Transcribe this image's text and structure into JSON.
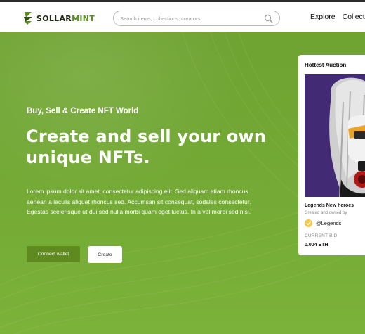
{
  "brand": {
    "name_prefix": "SOLLAR",
    "name_suffix": "MINT"
  },
  "search": {
    "placeholder": "Search items, collections, creators"
  },
  "nav": {
    "items": [
      "Explore",
      "Collections"
    ]
  },
  "hero": {
    "subtitle": "Buy, Sell & Create NFT World",
    "headline": "Create and sell your own unique NFTs.",
    "description": "Lorem ipsum dolor sit amet, consectetur adipiscing elit. Sed aliquam etiam rhoncus aenean a iaculis aliquet rhoncus sed. Accumsan sit consequat, sodales consectetur. Egestas scelerisque ut dui sed nulla morbi quam eget luctus. In a vel morbi sed nisi.",
    "connect_label": "Connect wallet",
    "create_label": "Create"
  },
  "auction": {
    "title": "Hottest Auction",
    "item_name": "Legends New heroes",
    "created_by_label": "Created and owned by",
    "owner_handle": "@Legends",
    "bid_label": "CURRENT BID",
    "bid_value": "0.004 ETH"
  },
  "colors": {
    "brand_green": "#5a8f1f",
    "hero_green": "#72a834",
    "connect_button": "#5e8a1f",
    "verified_badge": "#f2c94c"
  },
  "icons": [
    "logo-icon",
    "search-icon",
    "verified-icon"
  ]
}
